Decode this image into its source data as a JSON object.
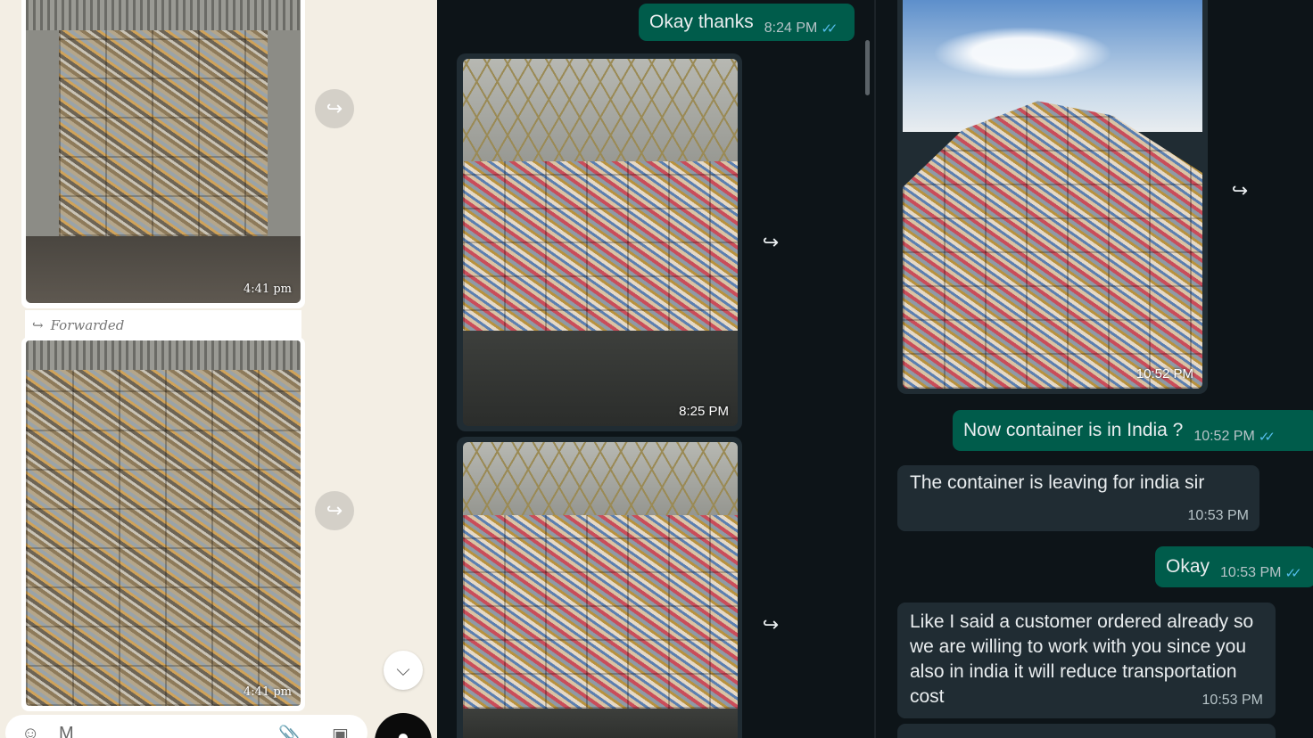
{
  "left_panel": {
    "photo1_time": "4:41 pm",
    "forwarded_label": "Forwarded",
    "photo2_time": "4:41 pm",
    "composer_text": "M"
  },
  "middle_panel": {
    "message1": {
      "text": "Okay thanks",
      "time": "8:24 PM"
    },
    "photo1_time": "8:25 PM"
  },
  "right_panel": {
    "photo_time": "10:52 PM",
    "messages": [
      {
        "direction": "out",
        "text": "Now container is in India ?",
        "time": "10:52 PM"
      },
      {
        "direction": "in",
        "text": "The container is leaving for india sir",
        "time": "10:53 PM"
      },
      {
        "direction": "out",
        "text": "Okay",
        "time": "10:53 PM"
      },
      {
        "direction": "in",
        "text": "Like I said a customer ordered already so we are willing to work with you since you also in india it will reduce transportation cost",
        "time": "10:53 PM"
      }
    ]
  },
  "icons": {
    "forward": "forward-icon",
    "scroll_down": "double-chevron-down-icon",
    "read_ticks": "double-check-icon",
    "mic": "mic-icon"
  },
  "colors": {
    "outgoing_bubble": "#005c4b",
    "incoming_bubble": "#202c33",
    "read_tick": "#53bdeb",
    "light_background": "#f3eee4",
    "dark_background": "#0d1418"
  }
}
